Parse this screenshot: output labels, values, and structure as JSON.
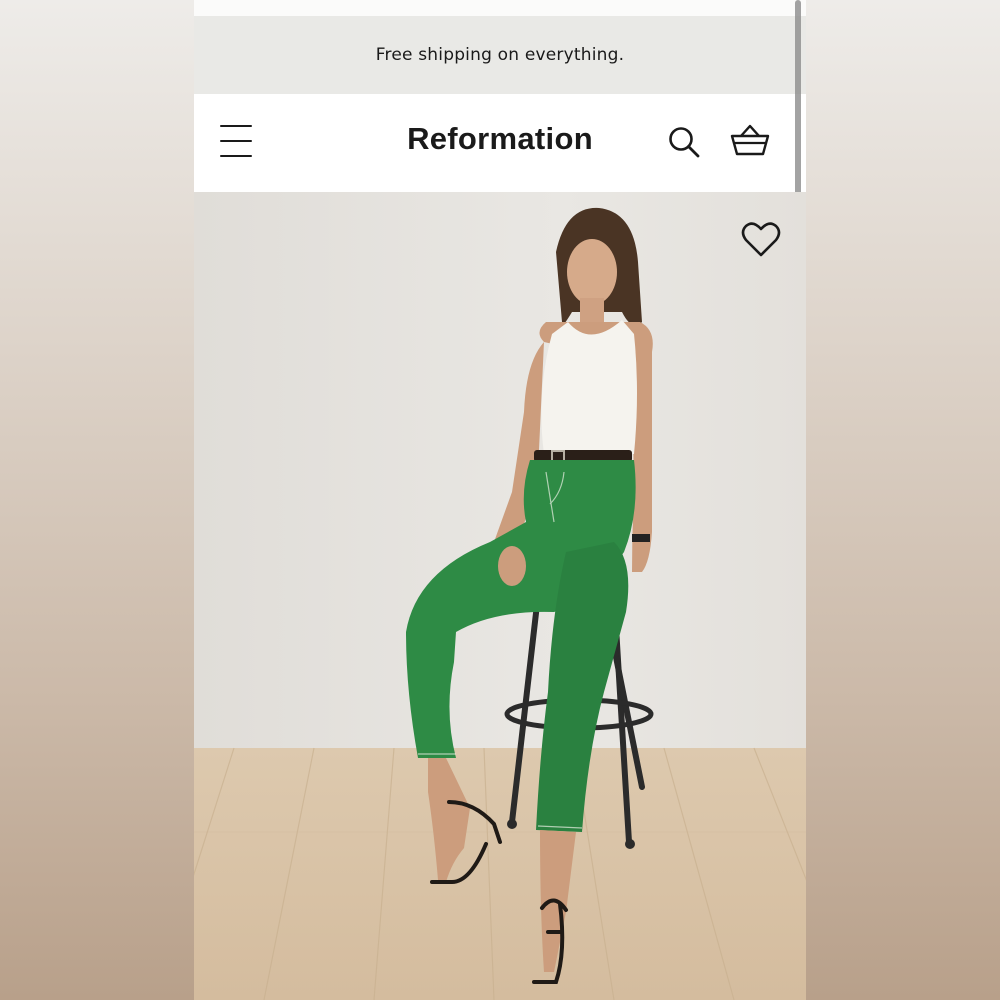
{
  "promo": {
    "text": "Free shipping on everything."
  },
  "header": {
    "logo": "Reformation",
    "icons": {
      "menu": "hamburger-menu-icon",
      "search": "search-icon",
      "cart": "basket-icon"
    }
  },
  "product": {
    "image_subject": "model-photo",
    "wishlist_icon": "heart-icon"
  },
  "colors": {
    "promo_bg": "#e9e9e6",
    "text": "#1a1a1a",
    "pants": "#2e8b45",
    "wall": "#e6e3de",
    "floor": "#d9c4a8"
  }
}
